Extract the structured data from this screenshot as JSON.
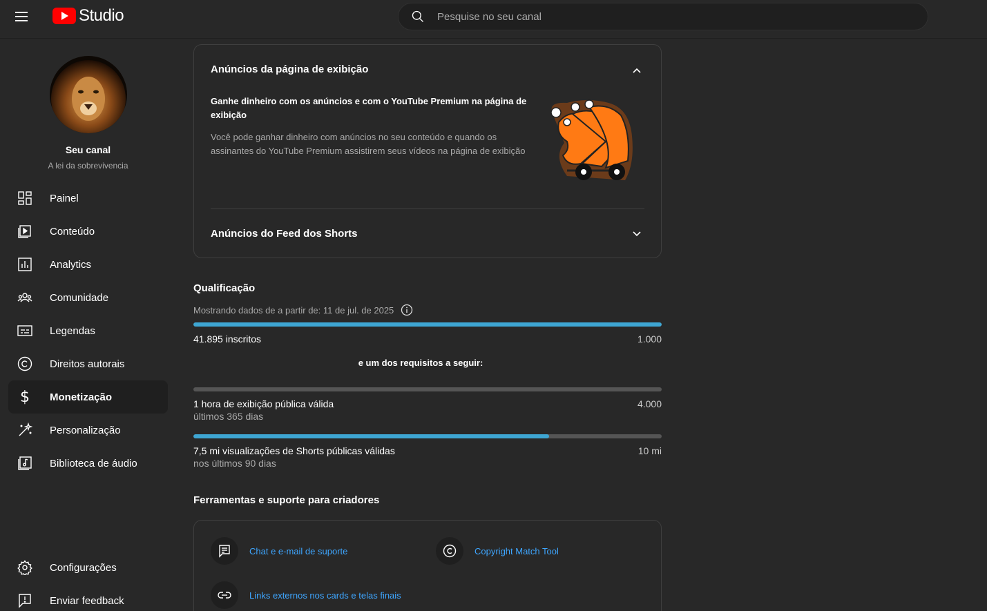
{
  "header": {
    "logo_text": "Studio",
    "search_placeholder": "Pesquise no seu canal"
  },
  "channel": {
    "name": "Seu canal",
    "subtitle": "A lei da sobrevivencia"
  },
  "sidebar": {
    "items": [
      {
        "label": "Painel",
        "icon": "dashboard-icon"
      },
      {
        "label": "Conteúdo",
        "icon": "content-icon"
      },
      {
        "label": "Analytics",
        "icon": "analytics-icon"
      },
      {
        "label": "Comunidade",
        "icon": "community-icon"
      },
      {
        "label": "Legendas",
        "icon": "subtitles-icon"
      },
      {
        "label": "Direitos autorais",
        "icon": "copyright-icon"
      },
      {
        "label": "Monetização",
        "icon": "dollar-icon",
        "active": true
      },
      {
        "label": "Personalização",
        "icon": "magic-wand-icon"
      },
      {
        "label": "Biblioteca de áudio",
        "icon": "audio-library-icon"
      }
    ],
    "bottom": [
      {
        "label": "Configurações",
        "icon": "gear-icon"
      },
      {
        "label": "Enviar feedback",
        "icon": "feedback-icon"
      }
    ]
  },
  "ads_card": {
    "title": "Anúncios da página de exibição",
    "headline": "Ganhe dinheiro com os anúncios e com o YouTube Premium na página de exibição",
    "description": "Você pode ganhar dinheiro com anúncios no seu conteúdo e quando os assinantes do YouTube Premium assistirem seus vídeos na página de exibição",
    "shorts_title": "Anúncios do Feed dos Shorts"
  },
  "qualification": {
    "title": "Qualificação",
    "subtitle": "Mostrando dados de a partir de: 11 de jul. de 2025",
    "subscribers": {
      "label": "41.895 inscritos",
      "target": "1.000",
      "progress": 1.0
    },
    "requirements_text": "e um dos requisitos a seguir:",
    "watch_hours": {
      "label": "1 hora de exibição pública válida",
      "sub": "últimos 365 dias",
      "target": "4.000",
      "progress": 0.0
    },
    "shorts_views": {
      "label": "7,5 mi visualizações de Shorts públicas válidas",
      "sub": "nos últimos 90 dias",
      "target": "10 mi",
      "progress": 0.76
    }
  },
  "tools": {
    "title": "Ferramentas e suporte para criadores",
    "items": [
      {
        "label": "Chat e e-mail de suporte",
        "icon": "chat-support-icon"
      },
      {
        "label": "Copyright Match Tool",
        "icon": "copyright-match-icon"
      },
      {
        "label": "Links externos nos cards e telas finais",
        "icon": "link-icon"
      }
    ]
  },
  "colors": {
    "accent": "#3ea6d3",
    "link": "#3ea6ff",
    "background": "#282828",
    "brand": "#ff0000"
  }
}
